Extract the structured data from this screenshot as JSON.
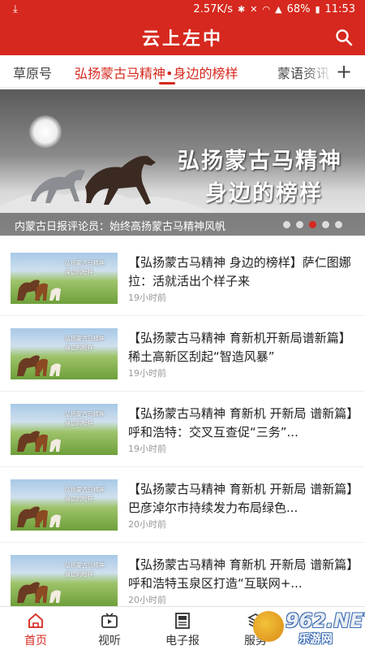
{
  "status_bar": {
    "left_icon": "download-icon",
    "network_speed": "2.57K/s",
    "battery": "68%",
    "time": "11:53"
  },
  "app_bar": {
    "title": "云上左中",
    "search_icon": "search-icon"
  },
  "tabs": [
    {
      "label": "草原号",
      "active": false
    },
    {
      "label": "弘扬蒙古马精神•身边的榜样",
      "active": true
    },
    {
      "label": "蒙语资讯",
      "active": false
    }
  ],
  "banner": {
    "headline_line1": "弘扬蒙古马精神",
    "headline_line2": "身边的榜样",
    "caption": "内蒙古日报评论员：始终高扬蒙古马精神风帆",
    "slide_count": 5,
    "active_slide": 3
  },
  "news": [
    {
      "title": "【弘扬蒙古马精神 身边的榜样】萨仁图娜拉：活就活出个样子来",
      "time": "19小时前"
    },
    {
      "title": "【弘扬蒙古马精神 育新机开新局谱新篇】稀土高新区刮起“智造风暴”",
      "time": "19小时前"
    },
    {
      "title": "【弘扬蒙古马精神 育新机 开新局 谱新篇】呼和浩特：交叉互查促“三务”...",
      "time": "19小时前"
    },
    {
      "title": "【弘扬蒙古马精神 育新机 开新局 谱新篇】巴彦淖尔市持续发力布局绿色...",
      "time": "20小时前"
    },
    {
      "title": "【弘扬蒙古马精神 育新机 开新局 谱新篇】呼和浩特玉泉区打造“互联网+...",
      "time": "20小时前"
    }
  ],
  "bottom_nav": [
    {
      "label": "首页",
      "icon": "home-icon",
      "active": true
    },
    {
      "label": "视听",
      "icon": "video-icon",
      "active": false
    },
    {
      "label": "电子报",
      "icon": "newspaper-icon",
      "active": false
    },
    {
      "label": "服务",
      "icon": "service-icon",
      "active": false
    }
  ],
  "watermark": {
    "main": "962.NET",
    "sub": "乐游网"
  },
  "colors": {
    "brand_red": "#d6281e"
  }
}
